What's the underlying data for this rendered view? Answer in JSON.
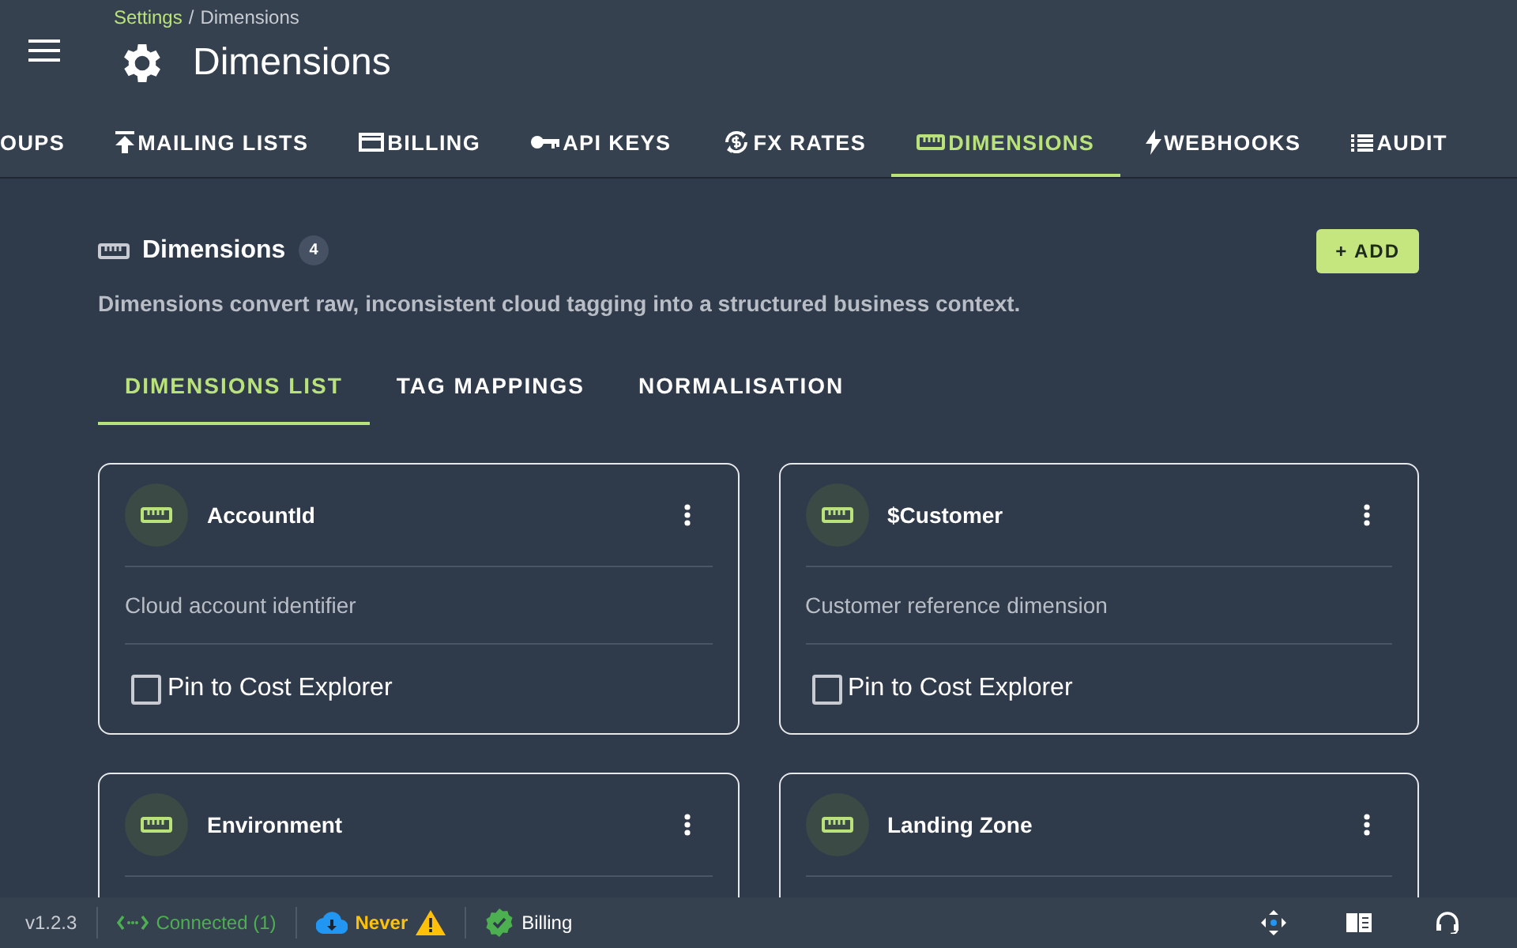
{
  "breadcrumb": {
    "link": "Settings",
    "separator": "/",
    "current": "Dimensions"
  },
  "page_title": "Dimensions",
  "tabs": [
    {
      "label": "OUPS",
      "selected": false
    },
    {
      "label": "MAILING LISTS",
      "selected": false
    },
    {
      "label": "BILLING",
      "selected": false
    },
    {
      "label": "API KEYS",
      "selected": false
    },
    {
      "label": "FX RATES",
      "selected": false
    },
    {
      "label": "DIMENSIONS",
      "selected": true
    },
    {
      "label": "WEBHOOKS",
      "selected": false
    },
    {
      "label": "AUDIT",
      "selected": false
    }
  ],
  "section": {
    "title": "Dimensions",
    "count": "4",
    "add_button": "+ ADD",
    "description": "Dimensions convert raw, inconsistent cloud tagging into a structured business context."
  },
  "subtabs": [
    {
      "label": "DIMENSIONS LIST",
      "selected": true
    },
    {
      "label": "TAG MAPPINGS",
      "selected": false
    },
    {
      "label": "NORMALISATION",
      "selected": false
    }
  ],
  "cards": [
    {
      "name": "AccountId",
      "description": "Cloud account identifier",
      "pin_label": "Pin to Cost Explorer",
      "checked": false
    },
    {
      "name": "$Customer",
      "description": "Customer reference dimension",
      "pin_label": "Pin to Cost Explorer",
      "checked": false
    },
    {
      "name": "Environment"
    },
    {
      "name": "Landing Zone"
    }
  ],
  "status_bar": {
    "version": "v1.2.3",
    "connection": "Connected (1)",
    "sync": "Never",
    "billing": "Billing"
  }
}
